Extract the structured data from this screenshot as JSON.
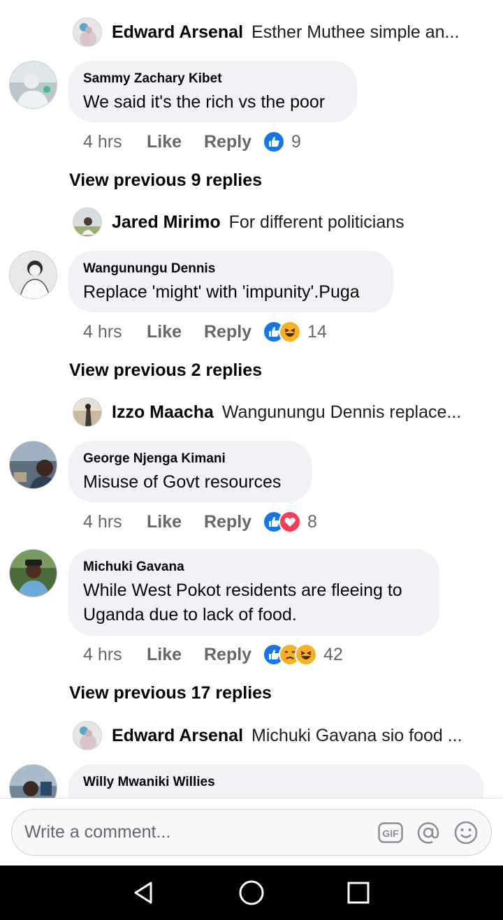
{
  "threads": [
    {
      "reply": {
        "name": "Edward Arsenal",
        "text": "Esther Muthee simple an..."
      }
    },
    {
      "comment": {
        "name": "Sammy Zachary Kibet",
        "lines": [
          "We said it's the rich vs the poor"
        ]
      },
      "actions": {
        "time": "4 hrs",
        "like": "Like",
        "reply": "Reply",
        "count": "9"
      },
      "view_previous": "View previous 9 replies",
      "reply": {
        "name": "Jared Mirimo",
        "text": "For different politicians"
      }
    },
    {
      "comment": {
        "name": "Wangunungu Dennis",
        "lines": [
          "Replace 'might' with 'impunity'.Puga"
        ]
      },
      "actions": {
        "time": "4 hrs",
        "like": "Like",
        "reply": "Reply",
        "count": "14"
      },
      "view_previous": "View previous 2 replies",
      "reply": {
        "name": "Izzo Maacha",
        "text": "Wangunungu Dennis replace..."
      }
    },
    {
      "comment": {
        "name": "George Njenga Kimani",
        "lines": [
          "Misuse of Govt resources"
        ]
      },
      "actions": {
        "time": "4 hrs",
        "like": "Like",
        "reply": "Reply",
        "count": "8"
      }
    },
    {
      "comment": {
        "name": "Michuki Gavana",
        "lines": [
          "While West Pokot residents are fleeing to",
          "Uganda due to lack of food."
        ]
      },
      "actions": {
        "time": "4 hrs",
        "like": "Like",
        "reply": "Reply",
        "count": "42"
      },
      "view_previous": "View previous 17 replies",
      "reply": {
        "name": "Edward Arsenal",
        "text": "Michuki Gavana sio food ..."
      }
    },
    {
      "comment": {
        "name": "Willy Mwaniki Willies"
      }
    }
  ],
  "reaction_icons": {
    "sammy": [
      "like-icon"
    ],
    "wangunungu": [
      "like-icon",
      "haha-icon"
    ],
    "george": [
      "like-icon",
      "love-icon"
    ],
    "michuki": [
      "like-icon",
      "care-icon",
      "haha-icon"
    ]
  },
  "composer": {
    "placeholder": "Write a comment...",
    "icons": [
      "gif-icon",
      "at-icon",
      "emoji-icon"
    ]
  },
  "navigation": {
    "icons": [
      "back-icon",
      "home-icon",
      "recents-icon"
    ]
  },
  "colors": {
    "like_blue": "#1b74e4",
    "love_red": "#f33e58",
    "emoji_yellow": "#f7b125",
    "secondary_text": "#65676b",
    "bubble_bg": "#f0f2f5"
  }
}
